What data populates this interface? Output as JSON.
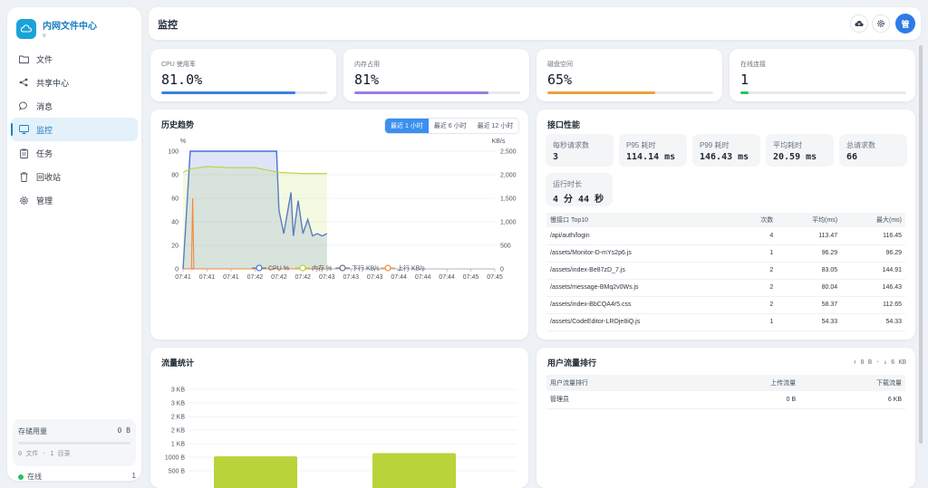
{
  "sidebar": {
    "brand_title": "内网文件中心",
    "brand_sub": "v",
    "items": [
      {
        "label": "文件"
      },
      {
        "label": "共享中心"
      },
      {
        "label": "消息"
      },
      {
        "label": "监控"
      },
      {
        "label": "任务"
      },
      {
        "label": "回收站"
      },
      {
        "label": "管理"
      }
    ],
    "storage_label": "存储用量",
    "storage_value": "0 B",
    "storage_sub": "0 文件 · 1 目录",
    "online_label": "在线",
    "online_count": "1"
  },
  "header": {
    "title": "监控",
    "avatar": "管"
  },
  "stats": [
    {
      "label": "CPU 使用率",
      "value": "81.0%",
      "fill": 0.81,
      "color": "#3b7fe0"
    },
    {
      "label": "内存占用",
      "value": "81%",
      "fill": 0.81,
      "color": "#9b7be6"
    },
    {
      "label": "磁盘空间",
      "value": "65%",
      "fill": 0.65,
      "color": "#e8a33b"
    },
    {
      "label": "在线连接",
      "value": "1",
      "fill": 0.05,
      "color": "#22c55e"
    }
  ],
  "history": {
    "title": "历史趋势",
    "tabs": [
      "最近 1 小时",
      "最近 6 小时",
      "最近 12 小时"
    ],
    "active_tab": 0
  },
  "perf": {
    "title": "接口性能",
    "metrics": [
      {
        "label": "每秒请求数",
        "value": "3"
      },
      {
        "label": "P95 耗时",
        "value": "114.14 ms"
      },
      {
        "label": "P99 耗时",
        "value": "146.43 ms"
      },
      {
        "label": "平均耗时",
        "value": "20.59 ms"
      },
      {
        "label": "总请求数",
        "value": "66"
      },
      {
        "label": "运行时长",
        "value": "4 分 44 秒"
      }
    ],
    "table_headers": [
      "慢接口 Top10",
      "次数",
      "平均(ms)",
      "最大(ms)"
    ],
    "rows": [
      [
        "/api/auth/login",
        "4",
        "113.47",
        "116.45"
      ],
      [
        "/assets/Monitor-D-mYs2p6.js",
        "1",
        "96.29",
        "96.29"
      ],
      [
        "/assets/index-Be87zD_7.js",
        "2",
        "83.05",
        "144.91"
      ],
      [
        "/assets/message-BMq2v0Ws.js",
        "2",
        "80.04",
        "146.43"
      ],
      [
        "/assets/index-BbCQA4r5.css",
        "2",
        "58.37",
        "112.65"
      ],
      [
        "/assets/CodeEditor-LROje8iQ.js",
        "1",
        "54.33",
        "54.33"
      ]
    ]
  },
  "traffic": {
    "title": "流量统计"
  },
  "user_traffic": {
    "title": "用户流量排行",
    "summary": "↑ 0 B · ↓ 6 KB",
    "headers": [
      "用户流量排行",
      "上传流量",
      "下载流量"
    ],
    "rows": [
      [
        "管理员",
        "0 B",
        "6 KB"
      ]
    ]
  },
  "chart_data": [
    {
      "type": "line",
      "title": "历史趋势",
      "ylabel": "%",
      "y2label": "KB/s",
      "ylim": [
        0,
        100
      ],
      "y2lim": [
        0,
        2500
      ],
      "yticks": [
        "0",
        "20",
        "40",
        "60",
        "80",
        "100"
      ],
      "y2ticks": [
        "0",
        "500",
        "1,000",
        "1,500",
        "2,000",
        "2,500"
      ],
      "xticks": [
        "07:41",
        "07:41",
        "07:41",
        "07:42",
        "07:42",
        "07:42",
        "07:43",
        "07:43",
        "07:43",
        "07:44",
        "07:44",
        "07:44",
        "07:45",
        "07:45"
      ],
      "legend": [
        "CPU %",
        "内存 %",
        "下行 KB/s",
        "上行 KB/s"
      ],
      "series": [
        {
          "name": "CPU %",
          "color": "#4a6fd8",
          "axis": "y",
          "points": [
            [
              0,
              0
            ],
            [
              0.3,
              100
            ],
            [
              1,
              100
            ],
            [
              3,
              100
            ],
            [
              3.9,
              100
            ],
            [
              4,
              50
            ],
            [
              4.2,
              30
            ],
            [
              4.5,
              65
            ],
            [
              4.6,
              28
            ],
            [
              4.8,
              58
            ],
            [
              5,
              30
            ],
            [
              5.2,
              42
            ],
            [
              5.4,
              28
            ],
            [
              5.6,
              30
            ],
            [
              5.8,
              28
            ],
            [
              6,
              30
            ]
          ]
        },
        {
          "name": "内存 %",
          "color": "#b8d43a",
          "axis": "y",
          "points": [
            [
              0,
              82
            ],
            [
              0.3,
              85
            ],
            [
              1,
              87
            ],
            [
              2,
              86
            ],
            [
              3,
              86
            ],
            [
              4,
              82
            ],
            [
              5,
              81
            ],
            [
              6,
              81
            ]
          ]
        },
        {
          "name": "下行 KB/s",
          "color": "#6b7280",
          "axis": "y2",
          "points": [
            [
              0,
              0
            ],
            [
              6,
              0
            ]
          ]
        },
        {
          "name": "上行 KB/s",
          "color": "#f08a3b",
          "axis": "y2",
          "points": [
            [
              0,
              0
            ],
            [
              0.35,
              0
            ],
            [
              0.4,
              1500
            ],
            [
              0.45,
              0
            ],
            [
              6,
              0
            ]
          ]
        }
      ]
    },
    {
      "type": "bar",
      "title": "流量统计",
      "yticks": [
        "500 B",
        "1000 B",
        "1 KB",
        "2 KB",
        "2 KB",
        "3 KB",
        "3 KB"
      ],
      "categories": [
        "",
        ""
      ],
      "values": [
        620,
        760
      ],
      "ylim": [
        0,
        3500
      ],
      "color": "#b8d43a"
    }
  ]
}
